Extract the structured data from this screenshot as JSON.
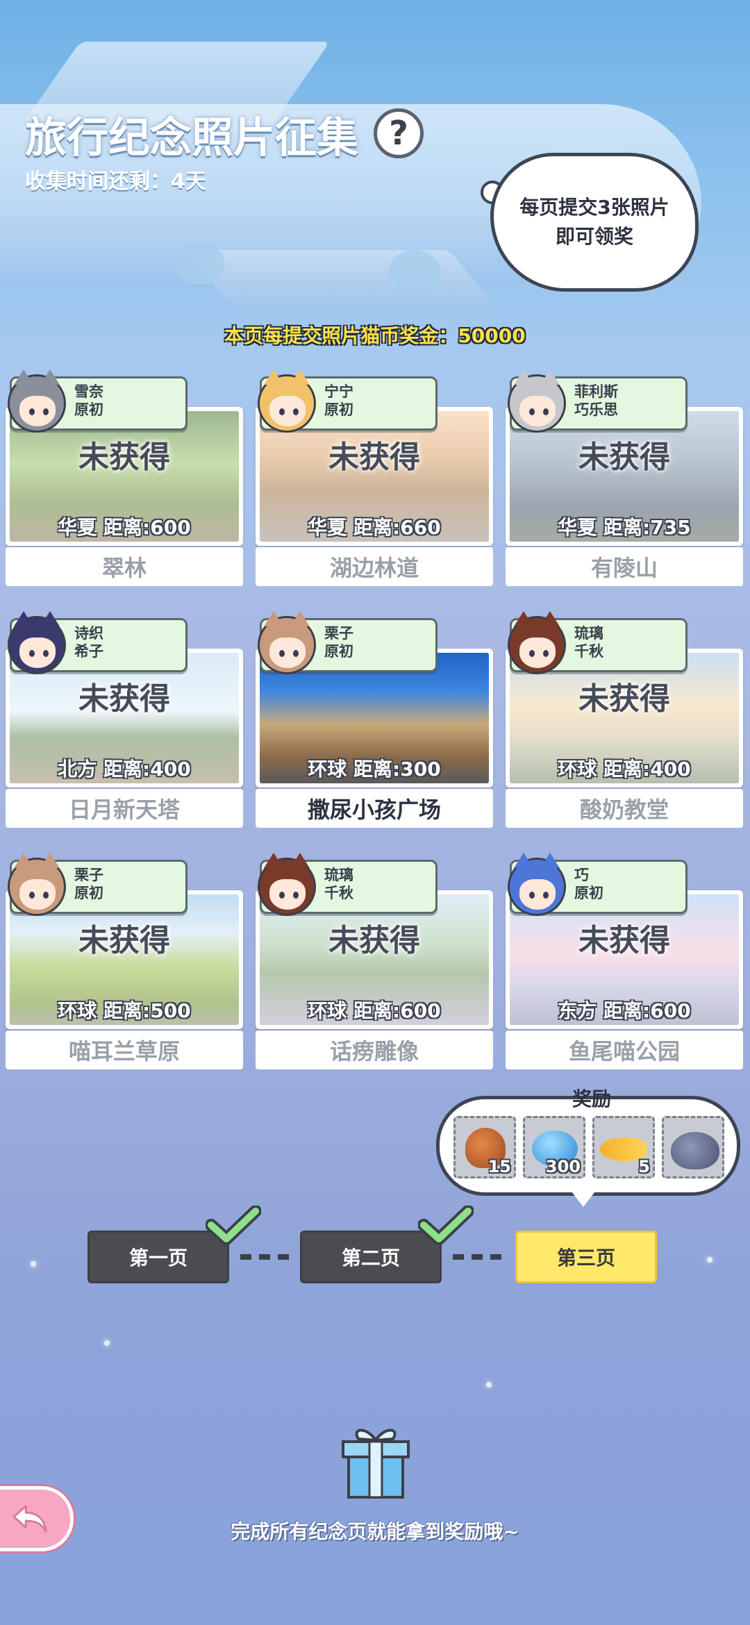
{
  "header": {
    "title": "旅行纪念照片征集",
    "help_label": "?",
    "time_left": "收集时间还剩：4天"
  },
  "bubble": {
    "line1": "每页提交3张照片",
    "line2": "即可领奖"
  },
  "bonus_text": "本页每提交照片猫币奖金：50000",
  "cards": [
    {
      "char1": "雪奈",
      "char2": "原初",
      "status": "未获得",
      "distance": "华夏  距离:600",
      "name": "翠林",
      "photo": "forest",
      "hair": "#8a8f9c"
    },
    {
      "char1": "宁宁",
      "char2": "原初",
      "status": "未获得",
      "distance": "华夏  距离:660",
      "name": "湖边林道",
      "photo": "lakepath",
      "hair": "#f1c26a"
    },
    {
      "char1": "菲利斯",
      "char2": "巧乐思",
      "status": "未获得",
      "distance": "华夏  距离:735",
      "name": "有陵山",
      "photo": "mountain",
      "hair": "#c5c7cc"
    },
    {
      "char1": "诗织",
      "char2": "希子",
      "status": "未获得",
      "distance": "北方  距离:400",
      "name": "日月新天塔",
      "photo": "ruins",
      "hair": "#3b3a6e"
    },
    {
      "char1": "栗子",
      "char2": "原初",
      "status": "",
      "distance": "环球  距离:300",
      "name": "撒尿小孩广场",
      "photo": "square",
      "hair": "#c99a7c"
    },
    {
      "char1": "琉璃",
      "char2": "千秋",
      "status": "未获得",
      "distance": "环球  距离:400",
      "name": "酸奶教堂",
      "photo": "church",
      "hair": "#7a3a2a"
    },
    {
      "char1": "栗子",
      "char2": "原初",
      "status": "未获得",
      "distance": "环球  距离:500",
      "name": "喵耳兰草原",
      "photo": "grassland",
      "hair": "#c99a7c"
    },
    {
      "char1": "琉璃",
      "char2": "千秋",
      "status": "未获得",
      "distance": "环球  距离:600",
      "name": "话痨雕像",
      "photo": "statue",
      "hair": "#7a3a2a"
    },
    {
      "char1": "巧",
      "char2": "原初",
      "status": "未获得",
      "distance": "东方  距离:600",
      "name": "鱼尾喵公园",
      "photo": "merlion",
      "hair": "#4d76d8"
    }
  ],
  "reward": {
    "title": "奖励",
    "items": [
      {
        "icon": "treasure-bag-icon",
        "count": "15"
      },
      {
        "icon": "blue-blob-icon",
        "count": "300"
      },
      {
        "icon": "fish-icon",
        "count": "5"
      },
      {
        "icon": "cat-plush-icon",
        "count": ""
      }
    ]
  },
  "pages": {
    "page1": "第一页",
    "page2": "第二页",
    "page3": "第三页"
  },
  "footer_text": "完成所有纪念页就能拿到奖励哦~",
  "colors": {
    "tag_bg": "#e4f7e0",
    "current_page": "#ffe86a",
    "done_page": "#4a4c52",
    "bonus_yellow": "#ffe14a"
  }
}
